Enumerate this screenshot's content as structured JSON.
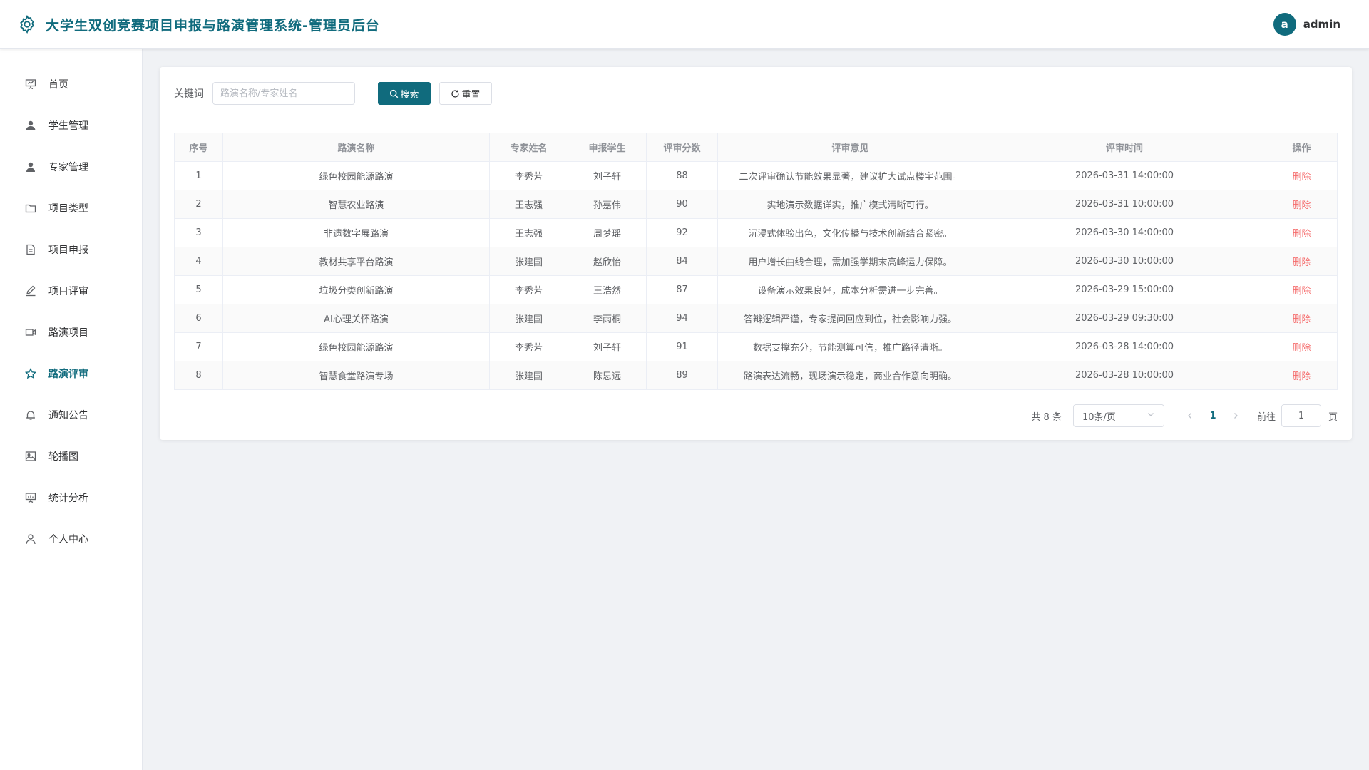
{
  "header": {
    "title": "大学生双创竞赛项目申报与路演管理系统-管理员后台",
    "avatar_letter": "a",
    "username": "admin"
  },
  "colors": {
    "primary": "#106b7d",
    "danger": "#f56c6c"
  },
  "sidebar": {
    "items": [
      {
        "label": "首页",
        "icon": "presentation-board-icon"
      },
      {
        "label": "学生管理",
        "icon": "user-filled-icon"
      },
      {
        "label": "专家管理",
        "icon": "user-filled-icon"
      },
      {
        "label": "项目类型",
        "icon": "folder-icon"
      },
      {
        "label": "项目申报",
        "icon": "document-icon"
      },
      {
        "label": "项目评审",
        "icon": "edit-pen-icon"
      },
      {
        "label": "路演项目",
        "icon": "video-camera-icon"
      },
      {
        "label": "路演评审",
        "icon": "star-icon",
        "active": true
      },
      {
        "label": "通知公告",
        "icon": "bell-icon"
      },
      {
        "label": "轮播图",
        "icon": "picture-icon"
      },
      {
        "label": "统计分析",
        "icon": "data-board-icon"
      },
      {
        "label": "个人中心",
        "icon": "user-outline-icon"
      }
    ]
  },
  "search": {
    "label": "关键词",
    "placeholder": "路演名称/专家姓名",
    "value": "",
    "search_label": "搜索",
    "reset_label": "重置"
  },
  "table": {
    "columns": [
      "序号",
      "路演名称",
      "专家姓名",
      "申报学生",
      "评审分数",
      "评审意见",
      "评审时间",
      "操作"
    ],
    "action_label": "删除",
    "rows": [
      [
        "1",
        "绿色校园能源路演",
        "李秀芳",
        "刘子轩",
        "88",
        "二次评审确认节能效果显著，建议扩大试点楼宇范围。",
        "2026-03-31 14:00:00"
      ],
      [
        "2",
        "智慧农业路演",
        "王志强",
        "孙嘉伟",
        "90",
        "实地演示数据详实，推广模式清晰可行。",
        "2026-03-31 10:00:00"
      ],
      [
        "3",
        "非遗数字展路演",
        "王志强",
        "周梦瑶",
        "92",
        "沉浸式体验出色，文化传播与技术创新结合紧密。",
        "2026-03-30 14:00:00"
      ],
      [
        "4",
        "教材共享平台路演",
        "张建国",
        "赵欣怡",
        "84",
        "用户增长曲线合理，需加强学期末高峰运力保障。",
        "2026-03-30 10:00:00"
      ],
      [
        "5",
        "垃圾分类创新路演",
        "李秀芳",
        "王浩然",
        "87",
        "设备演示效果良好，成本分析需进一步完善。",
        "2026-03-29 15:00:00"
      ],
      [
        "6",
        "AI心理关怀路演",
        "张建国",
        "李雨桐",
        "94",
        "答辩逻辑严谨，专家提问回应到位，社会影响力强。",
        "2026-03-29 09:30:00"
      ],
      [
        "7",
        "绿色校园能源路演",
        "李秀芳",
        "刘子轩",
        "91",
        "数据支撑充分，节能测算可信，推广路径清晰。",
        "2026-03-28 14:00:00"
      ],
      [
        "8",
        "智慧食堂路演专场",
        "张建国",
        "陈思远",
        "89",
        "路演表达流畅，现场演示稳定，商业合作意向明确。",
        "2026-03-28 10:00:00"
      ]
    ]
  },
  "pagination": {
    "total_text": "共 8 条",
    "page_size": "10条/页",
    "current_page": "1",
    "goto_label": "前往",
    "goto_value": "1",
    "page_unit": "页"
  }
}
